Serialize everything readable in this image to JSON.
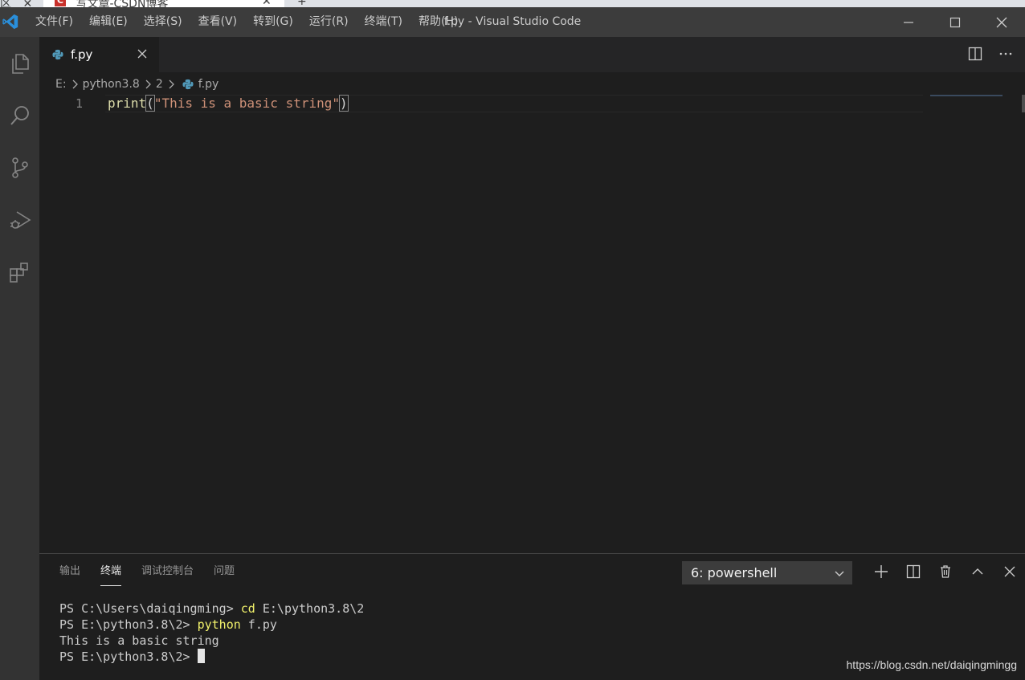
{
  "browser": {
    "tab_fragment": "区",
    "tab_title": "写文章-CSDN博客",
    "logo_letter": "C"
  },
  "titlebar": {
    "title": "f.py - Visual Studio Code",
    "menu": [
      "文件(F)",
      "编辑(E)",
      "选择(S)",
      "查看(V)",
      "转到(G)",
      "运行(R)",
      "终端(T)",
      "帮助(H)"
    ]
  },
  "activity_bar": [
    "explorer-icon",
    "search-icon",
    "source-control-icon",
    "run-debug-icon",
    "extensions-icon"
  ],
  "editor": {
    "tab_label": "f.py",
    "breadcrumb": [
      "E:",
      "python3.8",
      "2",
      "f.py"
    ],
    "line_number": "1",
    "code": {
      "fn": "print",
      "open_paren": "(",
      "string": "\"This is a basic string\"",
      "close_paren": ")"
    }
  },
  "panel": {
    "tabs": [
      "输出",
      "终端",
      "调试控制台",
      "问题"
    ],
    "active_tab_index": 1,
    "terminal_select": "6: powershell",
    "terminal_lines": [
      {
        "prompt": "PS C:\\Users\\daiqingming> ",
        "cmd": "cd",
        "args": " E:\\python3.8\\2"
      },
      {
        "prompt": "PS E:\\python3.8\\2> ",
        "cmd": "python",
        "args": " f.py"
      },
      {
        "prompt": "This is a basic string",
        "cmd": "",
        "args": ""
      },
      {
        "prompt": "PS E:\\python3.8\\2> ",
        "cmd": "",
        "args": ""
      }
    ]
  },
  "watermark": "https://blog.csdn.net/daiqingmingg",
  "colors": {
    "accent": "#007acc",
    "titlebar": "#3c3c3c",
    "activity_bar": "#333333",
    "editor_bg": "#1e1e1e",
    "python_icon": "#519aba"
  }
}
